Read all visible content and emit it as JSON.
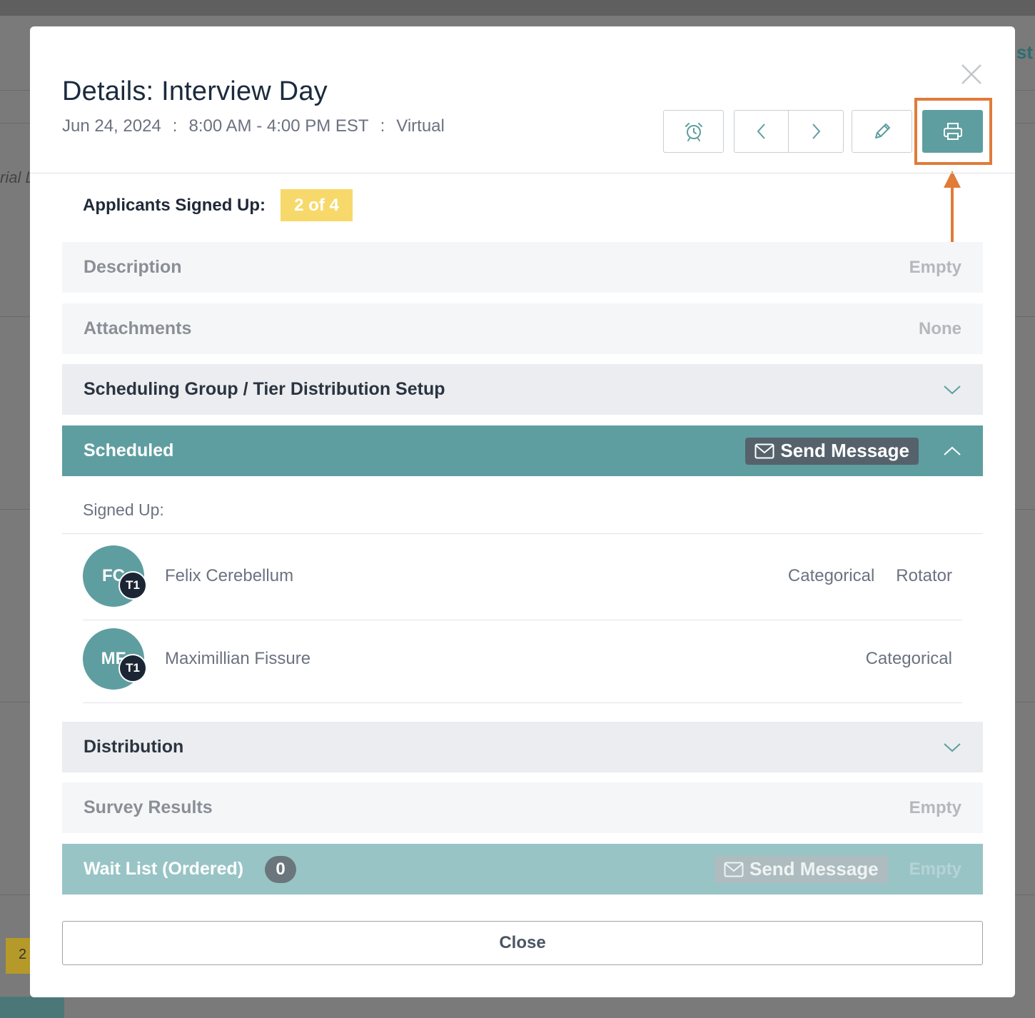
{
  "background": {
    "left_fragment": "rial L",
    "right_fragment": "tist",
    "cell_number": "2"
  },
  "modal": {
    "title": "Details: Interview Day",
    "date": "Jun 24, 2024",
    "separator": ":",
    "time": "8:00 AM - 4:00 PM EST",
    "location": "Virtual",
    "toolbar": {
      "icons": [
        "alarm-clock-icon",
        "chevron-left-icon",
        "chevron-right-icon",
        "pencil-icon",
        "printer-icon"
      ],
      "highlighted": "printer-icon",
      "highlight_color": "#e07b39"
    },
    "applicants_label": "Applicants Signed Up:",
    "applicants_badge": "2 of 4",
    "sections": {
      "description": {
        "label": "Description",
        "value": "Empty"
      },
      "attachments": {
        "label": "Attachments",
        "value": "None"
      },
      "scheduling_group": {
        "label": "Scheduling Group / Tier Distribution Setup"
      },
      "scheduled": {
        "label": "Scheduled",
        "send_message": "Send Message"
      },
      "distribution": {
        "label": "Distribution"
      },
      "survey_results": {
        "label": "Survey Results",
        "value": "Empty"
      },
      "wait_list": {
        "label": "Wait List (Ordered)",
        "count": "0",
        "send_message": "Send Message",
        "value": "Empty"
      }
    },
    "signed_up_label": "Signed Up:",
    "people": [
      {
        "initials": "FC",
        "tier": "T1",
        "name": "Felix Cerebellum",
        "tags": [
          "Categorical",
          "Rotator"
        ]
      },
      {
        "initials": "MF",
        "tier": "T1",
        "name": "Maximillian Fissure",
        "tags": [
          "Categorical"
        ]
      }
    ],
    "close_label": "Close"
  },
  "colors": {
    "accent_teal": "#5f9ea0",
    "badge_yellow": "#f7d96b",
    "highlight_orange": "#e07b39"
  }
}
